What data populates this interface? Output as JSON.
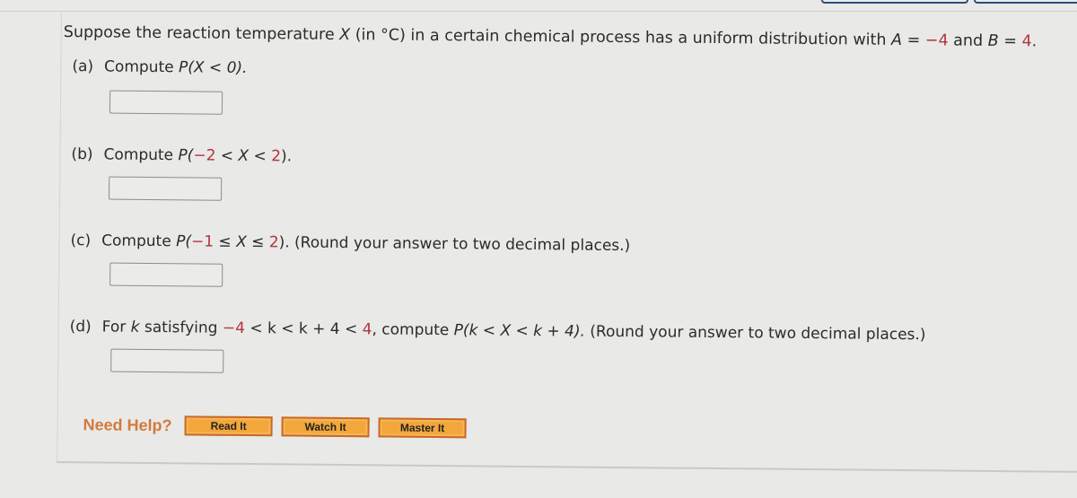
{
  "question": {
    "intro_prefix": "Suppose the reaction temperature ",
    "var_x": "X",
    "intro_middle": " (in °C) in a certain chemical process has a uniform distribution with ",
    "var_a": "A",
    "equals": " = ",
    "a_value": "−4",
    "and": " and ",
    "var_b": "B",
    "b_value": "4",
    "period": "."
  },
  "parts": [
    {
      "label": "(a)",
      "text_prefix": "Compute ",
      "expr": "P(X < 0).",
      "answer_value": ""
    },
    {
      "label": "(b)",
      "text_prefix": "Compute ",
      "expr_p": "P(",
      "expr_low": "−2",
      "expr_mid": " < X < ",
      "expr_high": "2",
      "expr_end": ").",
      "answer_value": ""
    },
    {
      "label": "(c)",
      "text_prefix": "Compute ",
      "expr_p": "P(",
      "expr_low": "−1",
      "expr_mid": " ≤ X ≤ ",
      "expr_high": "2",
      "expr_end": ").",
      "note": " (Round your answer to two decimal places.)",
      "answer_value": ""
    },
    {
      "label": "(d)",
      "text_prefix": "For ",
      "var_k": "k",
      "satisfying": " satisfying ",
      "cond_low": "−4",
      "cond_mid": " < k < k + 4 < ",
      "cond_high": "4",
      "compute": ", compute ",
      "expr": "P(k < X < k + 4).",
      "note": " (Round your answer to two decimal places.)",
      "answer_value": ""
    }
  ],
  "help": {
    "label": "Need Help?",
    "buttons": [
      "Read It",
      "Watch It",
      "Master It"
    ]
  }
}
